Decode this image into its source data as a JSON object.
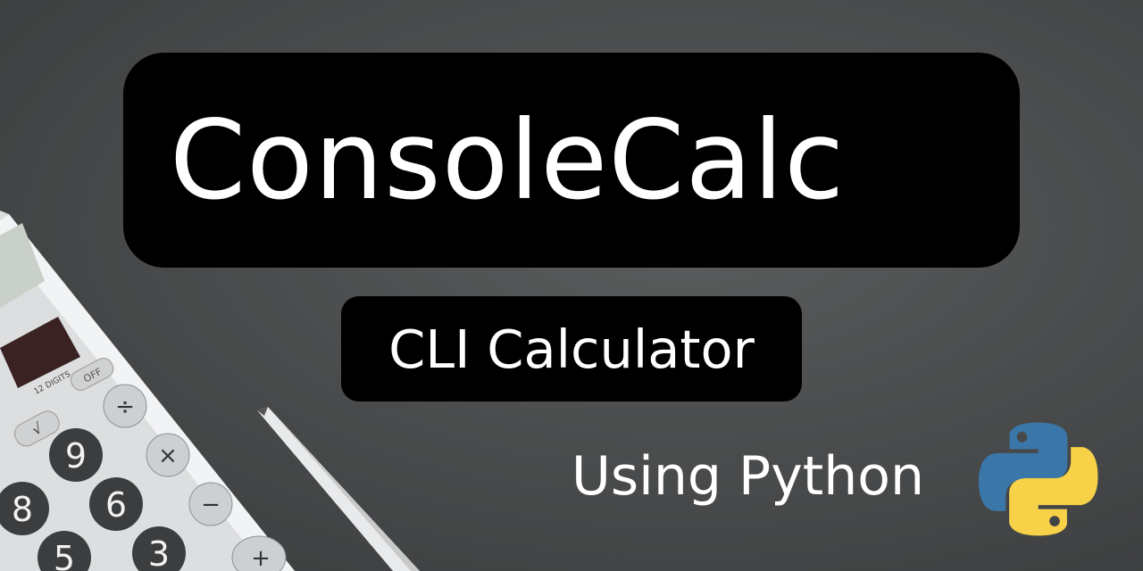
{
  "banner": {
    "title": "ConsoleCalc",
    "subtitle": "CLI Calculator",
    "tagline": "Using Python"
  },
  "calculator": {
    "display_label": "12 DIGITS",
    "off_key": "OFF",
    "keys": [
      "9",
      "6",
      "3",
      "8",
      "5",
      "÷",
      "×",
      "−",
      "+",
      "√"
    ]
  },
  "icons": {
    "python": "python-logo-icon",
    "pen": "pen-illustration",
    "calculator": "calculator-illustration"
  },
  "colors": {
    "background": "#4a4c4d",
    "box": "#000000",
    "text": "#ffffff",
    "python_blue": "#3a76a8",
    "python_yellow": "#f7d148"
  }
}
